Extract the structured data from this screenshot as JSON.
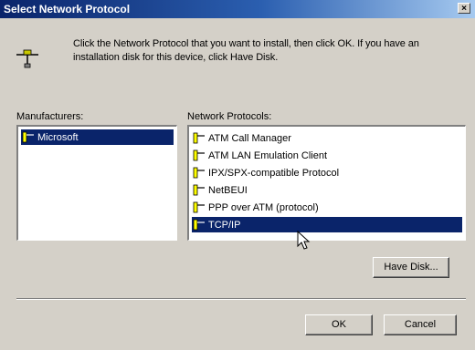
{
  "window": {
    "title": "Select Network Protocol",
    "close_glyph": "×"
  },
  "description": "Click the Network Protocol that you want to install, then click OK. If you have an installation disk for this device, click Have Disk.",
  "manufacturers": {
    "label": "Manufacturers:",
    "items": [
      {
        "label": "Microsoft",
        "selected": true
      }
    ]
  },
  "protocols": {
    "label": "Network Protocols:",
    "items": [
      {
        "label": "ATM Call Manager",
        "selected": false
      },
      {
        "label": "ATM LAN Emulation Client",
        "selected": false
      },
      {
        "label": "IPX/SPX-compatible Protocol",
        "selected": false
      },
      {
        "label": "NetBEUI",
        "selected": false
      },
      {
        "label": "PPP over ATM (protocol)",
        "selected": false
      },
      {
        "label": "TCP/IP",
        "selected": true
      }
    ]
  },
  "buttons": {
    "have_disk": "Have Disk...",
    "ok": "OK",
    "cancel": "Cancel"
  },
  "colors": {
    "selection": "#0a246a",
    "dialog_bg": "#d4d0c8"
  },
  "icons": {
    "protocol": "network-protocol-icon",
    "manufacturer": "manufacturer-icon",
    "cursor": "mouse-pointer-icon"
  }
}
